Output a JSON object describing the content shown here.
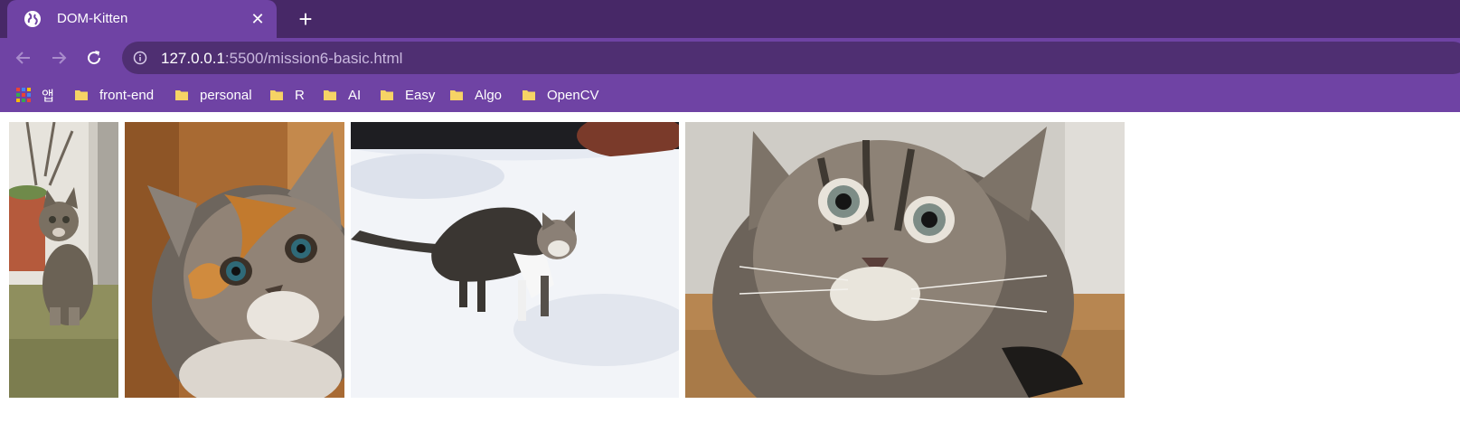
{
  "tab": {
    "title": "DOM-Kitten",
    "close": "✕"
  },
  "new_tab": "+",
  "address": {
    "host": "127.0.0.1",
    "rest": ":5500/mission6-basic.html"
  },
  "bookmarks": [
    {
      "label": "앱",
      "icon": "apps-grid-icon"
    },
    {
      "label": "front-end",
      "icon": "folder-icon"
    },
    {
      "label": "personal",
      "icon": "folder-icon"
    },
    {
      "label": "R",
      "icon": "folder-icon"
    },
    {
      "label": "AI",
      "icon": "folder-icon"
    },
    {
      "label": "Easy",
      "icon": "folder-icon"
    },
    {
      "label": "Algo",
      "icon": "folder-icon"
    },
    {
      "label": "OpenCV",
      "icon": "folder-icon"
    }
  ],
  "images": [
    {
      "subject": "tabby kitten sitting by a wall"
    },
    {
      "subject": "calico kitten close-up"
    },
    {
      "subject": "tabby kitten walking in snow"
    },
    {
      "subject": "tabby kitten face close-up"
    }
  ],
  "colors": {
    "frame": "#472867",
    "toolbar": "#6f43a4",
    "omnibox": "#4f2f72",
    "folder": "#f6d365"
  }
}
